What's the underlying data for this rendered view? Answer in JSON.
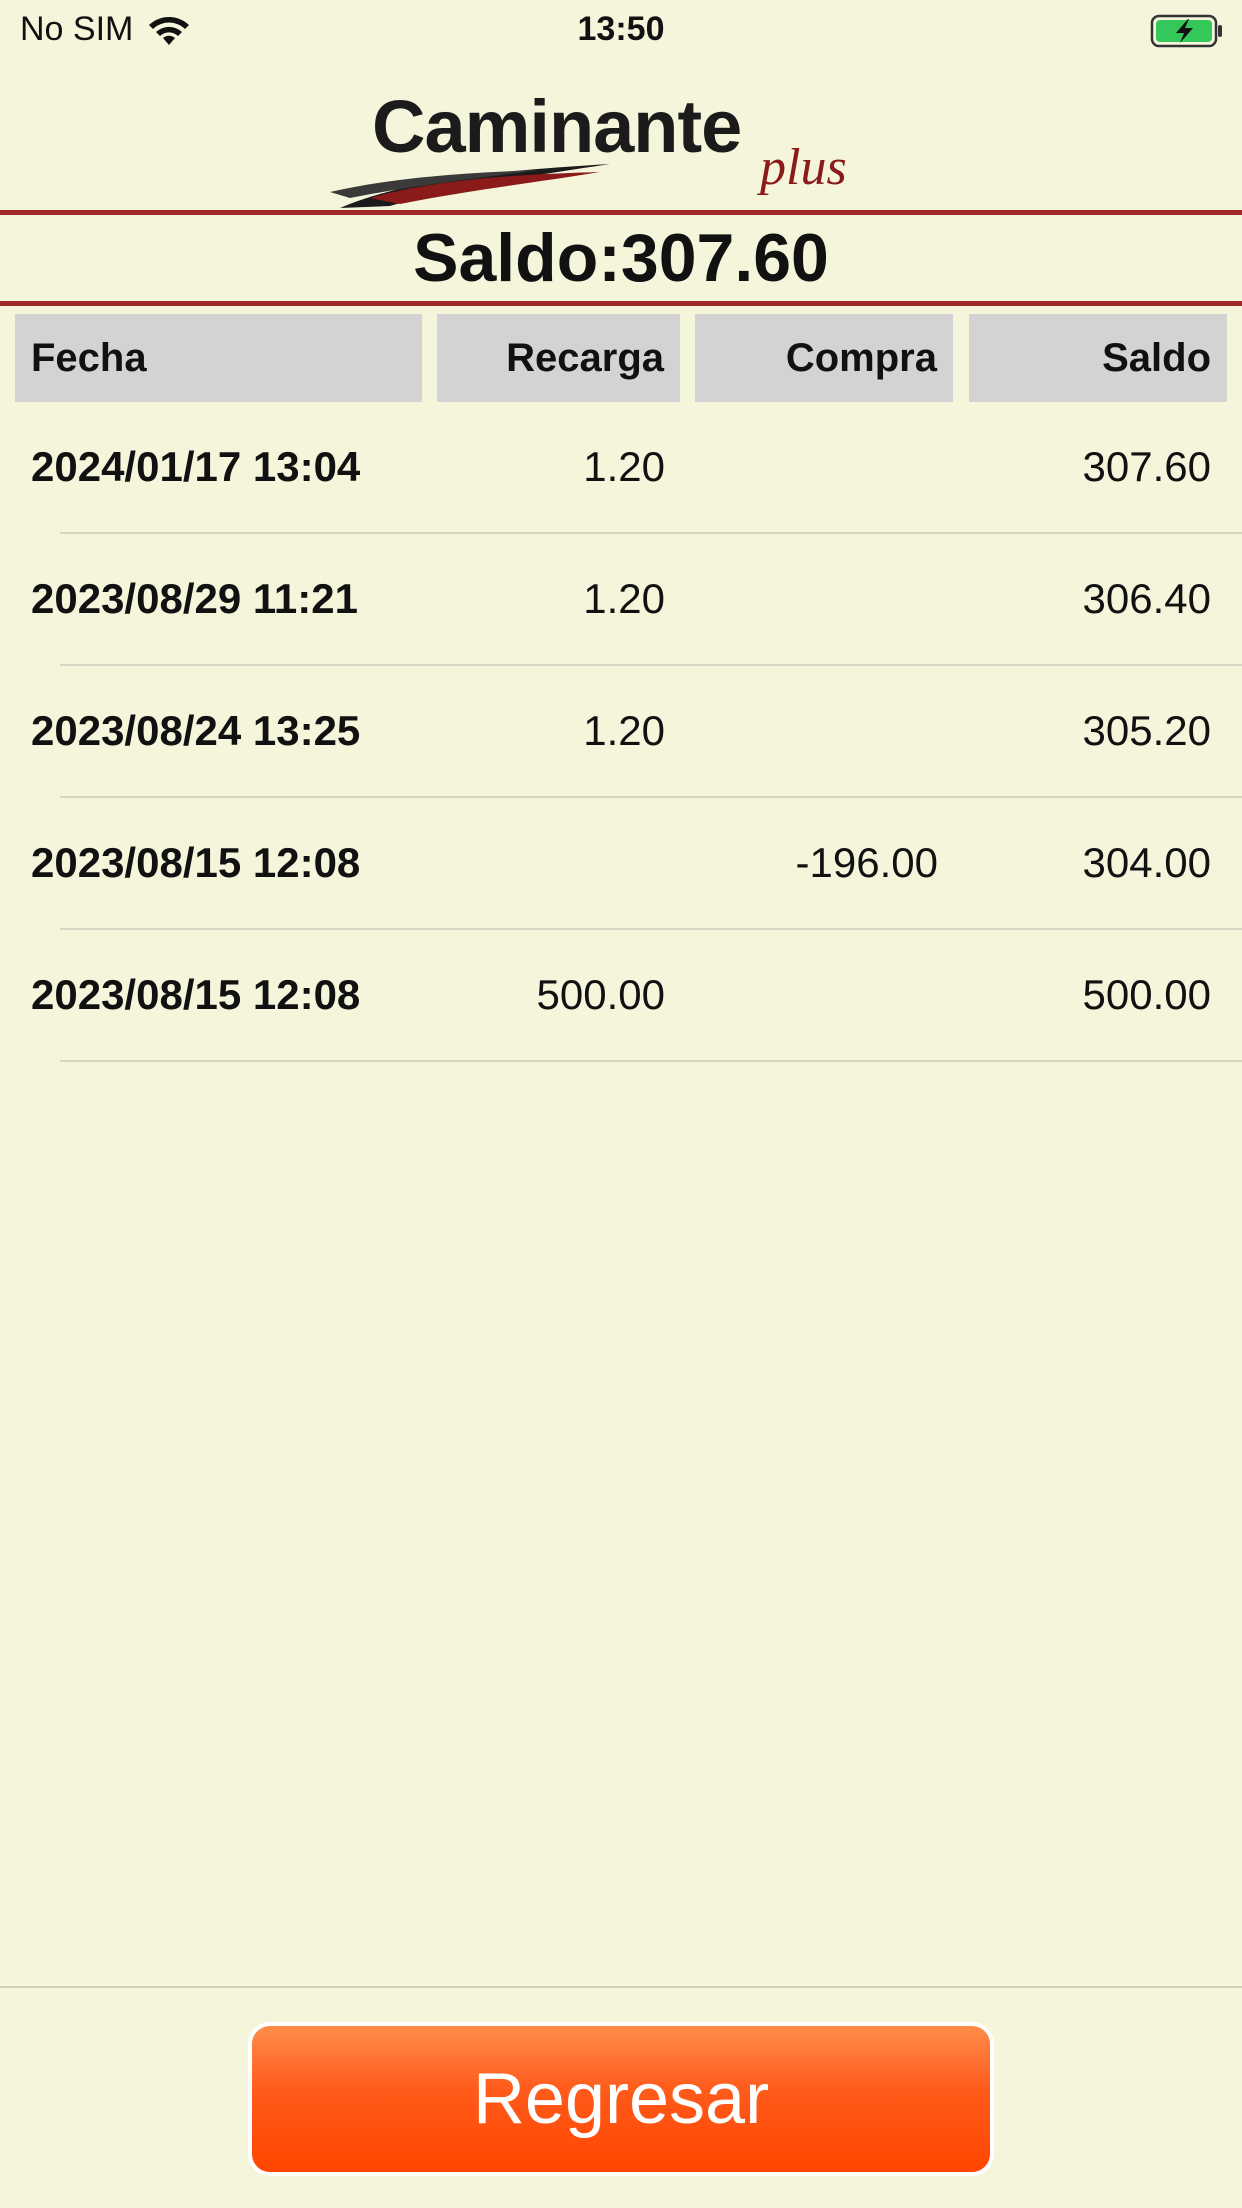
{
  "status_bar": {
    "carrier": "No SIM",
    "time": "13:50",
    "icons": [
      "wifi-icon",
      "battery-charging-icon"
    ]
  },
  "logo": {
    "text": "Caminante",
    "suffix": "plus",
    "colors": {
      "text": "#1b1b1b",
      "accent": "#8b1a1a"
    }
  },
  "balance": {
    "text": "Saldo:307.60"
  },
  "table": {
    "headers": [
      "Fecha",
      "Recarga",
      "Compra",
      "Saldo"
    ],
    "rows": [
      {
        "fecha": "2024/01/17 13:04",
        "recarga": "1.20",
        "compra": "",
        "saldo": "307.60"
      },
      {
        "fecha": "2023/08/29 11:21",
        "recarga": "1.20",
        "compra": "",
        "saldo": "306.40"
      },
      {
        "fecha": "2023/08/24 13:25",
        "recarga": "1.20",
        "compra": "",
        "saldo": "305.20"
      },
      {
        "fecha": "2023/08/15 12:08",
        "recarga": "",
        "compra": "-196.00",
        "saldo": "304.00"
      },
      {
        "fecha": "2023/08/15 12:08",
        "recarga": "500.00",
        "compra": "",
        "saldo": "500.00"
      }
    ]
  },
  "footer": {
    "back_label": "Regresar"
  },
  "colors": {
    "background": "#f5f5dc",
    "divider": "#a02828",
    "header_bg": "#d3d3d3",
    "button_top": "#ff8c4a",
    "button_bottom": "#ff4500"
  }
}
